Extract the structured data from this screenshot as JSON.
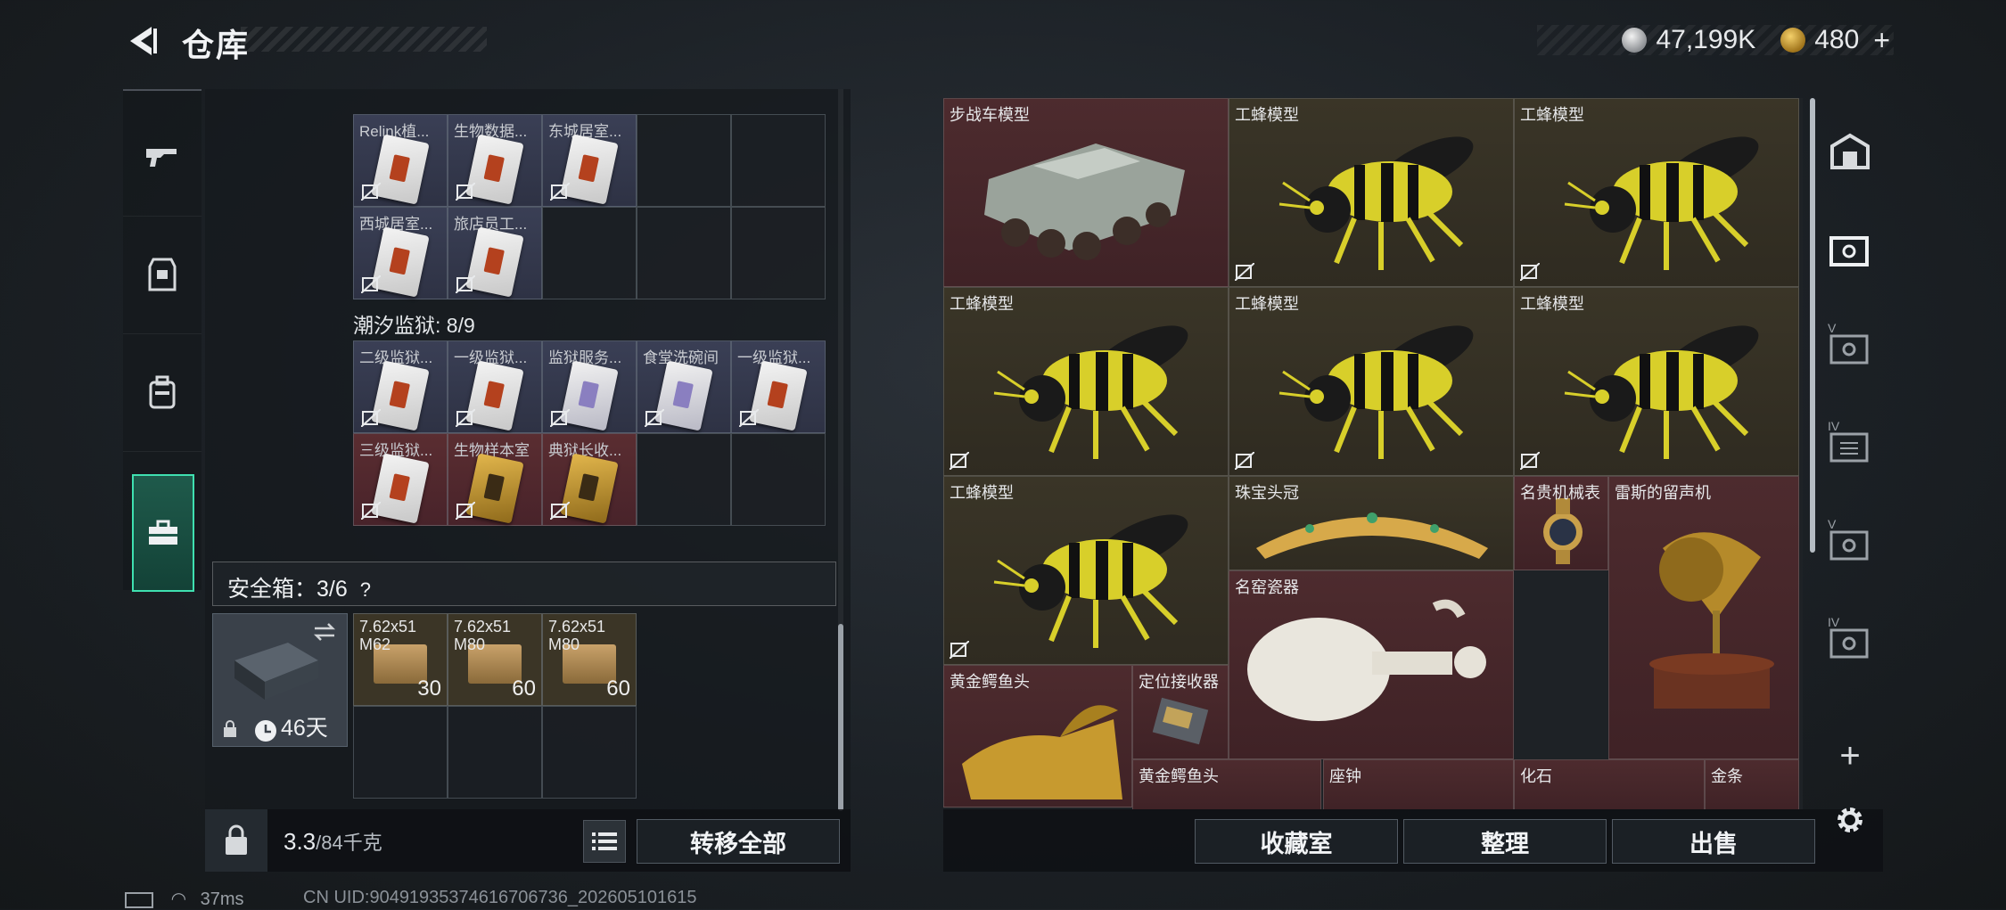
{
  "header": {
    "title": "仓库",
    "back_icon": "back-arrow-icon"
  },
  "currency": {
    "silver": "47,199K",
    "gold": "480",
    "plus": "+"
  },
  "left_nav": [
    {
      "name": "weapons",
      "icon": "gun-icon"
    },
    {
      "name": "equipment",
      "icon": "armor-icon"
    },
    {
      "name": "backpack",
      "icon": "backpack-icon"
    },
    {
      "name": "items",
      "icon": "toolbox-icon",
      "active": true
    }
  ],
  "cards_top": {
    "row1": [
      "Relink植...",
      "生物数据...",
      "东城居室..."
    ],
    "row2": [
      "西城居室...",
      "旅店员工..."
    ]
  },
  "prison": {
    "title": "潮汐监狱: 8/9",
    "row1": [
      "二级监狱...",
      "一级监狱...",
      "监狱服务...",
      "食堂洗碗间",
      "一级监狱..."
    ],
    "row2": [
      "三级监狱...",
      "生物样本室",
      "典狱长收..."
    ]
  },
  "safe": {
    "label": "安全箱：3/6",
    "help": "?",
    "days": "46天",
    "ammo": [
      {
        "name": "7.62x51\nM62",
        "count": "30"
      },
      {
        "name": "7.62x51\nM80",
        "count": "60"
      },
      {
        "name": "7.62x51\nM80",
        "count": "60"
      }
    ]
  },
  "bottom_left": {
    "weight": "3.3",
    "weight_max": "/84千克",
    "transfer_all": "转移全部"
  },
  "stash": {
    "items": [
      {
        "label": "步战车模型"
      },
      {
        "label": "工蜂模型"
      },
      {
        "label": "工蜂模型"
      },
      {
        "label": "工蜂模型"
      },
      {
        "label": "工蜂模型"
      },
      {
        "label": "工蜂模型"
      },
      {
        "label": "工蜂模型"
      },
      {
        "label": "珠宝头冠"
      },
      {
        "label": "名贵机械表"
      },
      {
        "label": "雷斯的留声机"
      },
      {
        "label": "名窑瓷器"
      },
      {
        "label": "黄金鳄鱼头"
      },
      {
        "label": "定位接收器"
      },
      {
        "label": "黄金鳄鱼头"
      },
      {
        "label": "座钟"
      },
      {
        "label": "化石"
      },
      {
        "label": "金条"
      }
    ]
  },
  "bottom_right": {
    "collection": "收藏室",
    "sort": "整理",
    "sell": "出售"
  },
  "right_nav": {
    "labels": [
      "",
      "",
      "V",
      "IV",
      "V",
      "IV"
    ],
    "add": "+"
  },
  "status": {
    "ping": "37ms",
    "uid": "CN UID:9049193537461670673​6_202605101615"
  },
  "colors": {
    "accent": "#3fe0b0",
    "red_item": "#4d2b2e",
    "olive_item": "#3a3527"
  }
}
